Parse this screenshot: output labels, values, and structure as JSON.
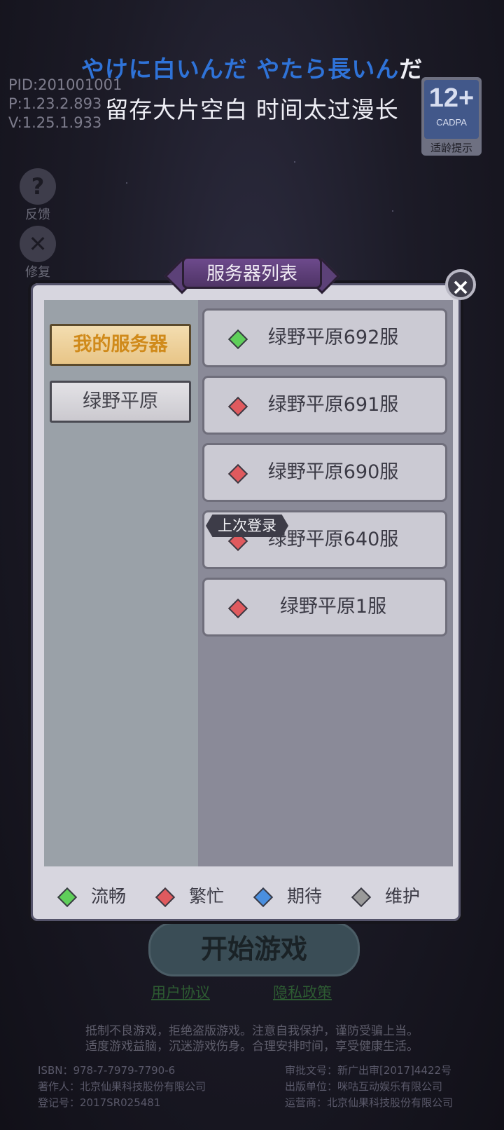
{
  "subtitles": {
    "line1_part1": "やけに白いんだ やたら長いん",
    "line1_part2": "だ",
    "line2": "留存大片空白 时间太过漫长"
  },
  "build_info": {
    "pid": "PID:201001001",
    "p": "P:1.23.2.893",
    "v": "V:1.25.1.933"
  },
  "age_rating": {
    "number": "12+",
    "org": "CADPA",
    "tip": "适龄提示"
  },
  "side_buttons": [
    {
      "icon": "question-icon",
      "label": "反馈"
    },
    {
      "icon": "tools-icon",
      "label": "修复"
    }
  ],
  "dialog": {
    "title": "服务器列表",
    "tabs": [
      {
        "label": "我的服务器",
        "active": true
      },
      {
        "label": "绿野平原",
        "active": false
      }
    ],
    "servers": [
      {
        "name": "绿野平原692服",
        "status": "流畅",
        "color": "#5fcf5a"
      },
      {
        "name": "绿野平原691服",
        "status": "繁忙",
        "color": "#e05a5e"
      },
      {
        "name": "绿野平原690服",
        "status": "繁忙",
        "color": "#e05a5e"
      },
      {
        "name": "绿野平原640服",
        "status": "繁忙",
        "color": "#e05a5e"
      },
      {
        "name": "绿野平原1服",
        "status": "繁忙",
        "color": "#e05a5e"
      }
    ],
    "last_login_badge": "上次登录",
    "legend": [
      {
        "label": "流畅",
        "color": "#5fcf5a"
      },
      {
        "label": "繁忙",
        "color": "#e05a5e"
      },
      {
        "label": "期待",
        "color": "#4a8fdf"
      },
      {
        "label": "维护",
        "color": "#9a9a9a"
      }
    ]
  },
  "start_button": "开始游戏",
  "links": {
    "user_agreement": "用户协议",
    "privacy_policy": "隐私政策"
  },
  "health_notice": {
    "line1": "抵制不良游戏，拒绝盗版游戏。注意自我保护，谨防受骗上当。",
    "line2": "适度游戏益脑，沉迷游戏伤身。合理安排时间，享受健康生活。"
  },
  "credits": {
    "isbn": "ISBN：978-7-7979-7790-6",
    "author": "著作人：北京仙果科技股份有限公司",
    "reg": "登记号：2017SR025481",
    "approval": "审批文号：新广出审[2017]4422号",
    "publisher": "出版单位：咪咕互动娱乐有限公司",
    "operator": "运营商：北京仙果科技股份有限公司"
  },
  "colors": {
    "subtitle_blue": "#2f73d8",
    "subtitle_white": "#eeeef5",
    "dialog_bg": "#d7d6df",
    "title_purple": "#5b3e77"
  }
}
